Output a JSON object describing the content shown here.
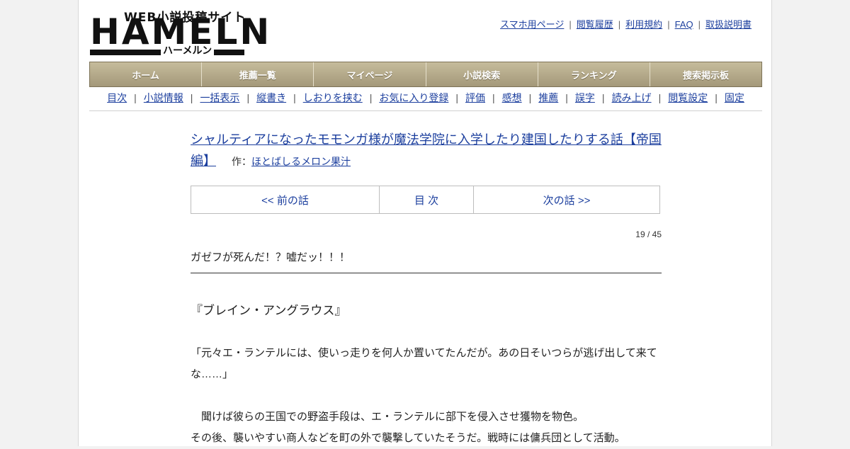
{
  "logo": {
    "sub": "WEB小説投稿サイト",
    "main": "HAMELN",
    "kana": "ハーメルン"
  },
  "top_links": [
    "スマホ用ページ",
    "閲覧履歴",
    "利用規約",
    "FAQ",
    "取扱説明書"
  ],
  "nav": [
    "ホーム",
    "推薦一覧",
    "マイページ",
    "小説検索",
    "ランキング",
    "捜索掲示板"
  ],
  "sub_nav": [
    "目次",
    "小説情報",
    "一括表示",
    "縦書き",
    "しおりを挟む",
    "お気に入り登録",
    "評価",
    "感想",
    "推薦",
    "誤字",
    "読み上げ",
    "閲覧設定",
    "固定"
  ],
  "story": {
    "title": "シャルティアになったモモンガ様が魔法学院に入学したり建国したりする話【帝国編】",
    "author_prefix": "作：",
    "author": "ほとばしるメロン果汁"
  },
  "pager": {
    "prev": "<< 前の話",
    "toc": "目 次",
    "next": "次の話 >>"
  },
  "counter": "19 / 45",
  "episode_title": "ガゼフが死んだ！？嘘だッ！！！",
  "body": {
    "line1": "『ブレイン・アングラウス』",
    "line2": "「元々エ・ランテルには、使いっ走りを何人か置いてたんだが。あの日そいつらが逃げ出して来てな……」",
    "line3": "　聞けば彼らの王国での野盗手段は、エ・ランテルに部下を侵入させ獲物を物色。",
    "line4": "その後、襲いやすい商人などを町の外で襲撃していたそうだ。戦時には傭兵団として活動。"
  },
  "colors": {
    "link": "#1c3f9e",
    "nav_bg": "#b2a788"
  }
}
